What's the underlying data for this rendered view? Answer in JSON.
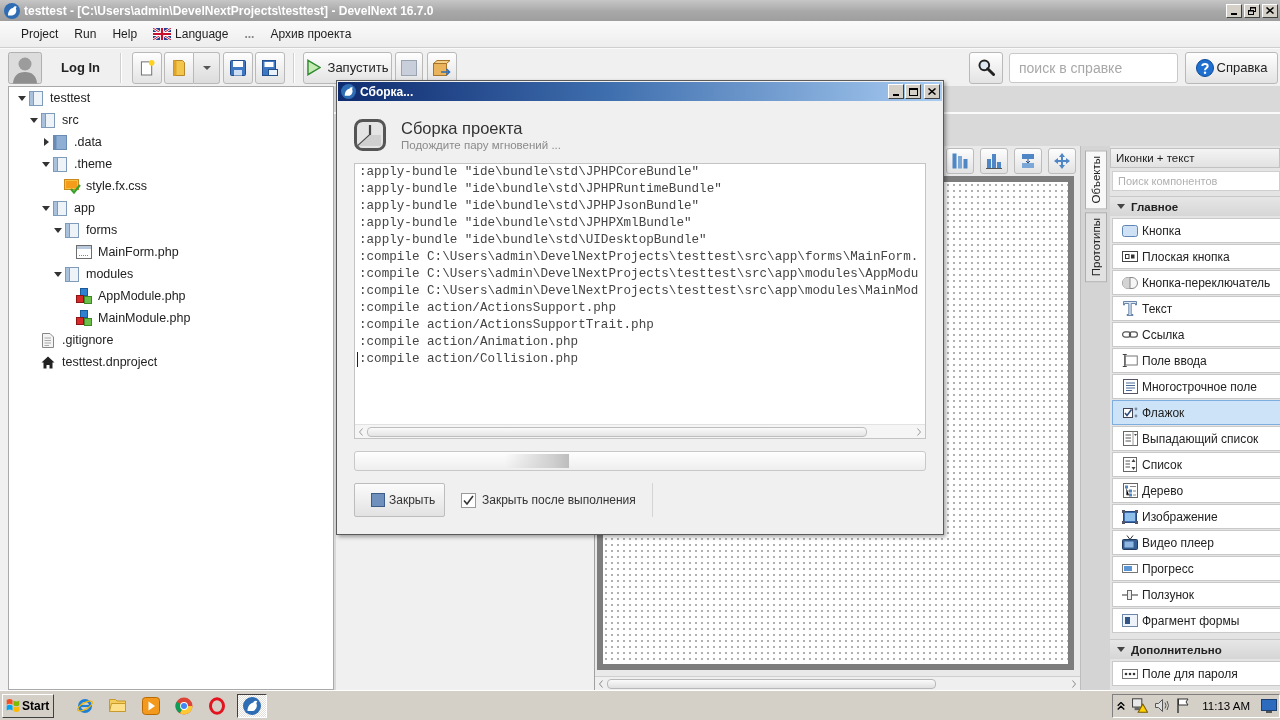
{
  "window": {
    "title": "testtest - [C:\\Users\\admin\\DevelNextProjects\\testtest] - DevelNext 16.7.0"
  },
  "menu": [
    {
      "label": "Project",
      "kind": "plain",
      "disabled": false
    },
    {
      "label": "Run",
      "kind": "plain",
      "disabled": false
    },
    {
      "label": "Help",
      "kind": "plain",
      "disabled": false
    },
    {
      "label": "Language",
      "kind": "flag",
      "disabled": false
    },
    {
      "label": "...",
      "kind": "plain",
      "disabled": true
    },
    {
      "label": "Архив проекта",
      "kind": "plain",
      "disabled": false
    }
  ],
  "toolbar": {
    "login": "Log In",
    "run_label": "Запустить",
    "help_search": {
      "placeholder": "поиск в справке"
    },
    "help_label": "Справка"
  },
  "project_tree": [
    {
      "label": "testtest",
      "kind": "folder",
      "expanded": true,
      "children": [
        {
          "label": "src",
          "kind": "folder",
          "expanded": true,
          "children": [
            {
              "label": ".data",
              "kind": "folder",
              "expanded": false
            },
            {
              "label": ".theme",
              "kind": "folder",
              "expanded": true,
              "children": [
                {
                  "label": "style.fx.css",
                  "kind": "stylesheet"
                }
              ]
            },
            {
              "label": "app",
              "kind": "folder",
              "expanded": true,
              "children": [
                {
                  "label": "forms",
                  "kind": "folder",
                  "expanded": true,
                  "children": [
                    {
                      "label": "MainForm.php",
                      "kind": "form"
                    }
                  ]
                },
                {
                  "label": "modules",
                  "kind": "folder",
                  "expanded": true,
                  "children": [
                    {
                      "label": "AppModule.php",
                      "kind": "module"
                    },
                    {
                      "label": "MainModule.php",
                      "kind": "module"
                    }
                  ]
                }
              ]
            }
          ]
        },
        {
          "label": ".gitignore",
          "kind": "text"
        },
        {
          "label": "testtest.dnproject",
          "kind": "project"
        }
      ]
    }
  ],
  "build_dialog": {
    "title": "Сборка...",
    "heading": "Сборка проекта",
    "subtitle": "Подождите пару мгновений ...",
    "log": [
      ":apply-bundle \"ide\\bundle\\std\\JPHPCoreBundle\"",
      ":apply-bundle \"ide\\bundle\\std\\JPHPRuntimeBundle\"",
      ":apply-bundle \"ide\\bundle\\std\\JPHPJsonBundle\"",
      ":apply-bundle \"ide\\bundle\\std\\JPHPXmlBundle\"",
      ":apply-bundle \"ide\\bundle\\std\\UIDesktopBundle\"",
      ":compile C:\\Users\\admin\\DevelNextProjects\\testtest\\src\\app\\forms\\MainForm.",
      ":compile C:\\Users\\admin\\DevelNextProjects\\testtest\\src\\app\\modules\\AppModu",
      ":compile C:\\Users\\admin\\DevelNextProjects\\testtest\\src\\app\\modules\\MainMod",
      ":compile action/ActionsSupport.php",
      ":compile action/ActionsSupportTrait.php",
      ":compile action/Animation.php",
      ":compile action/Collision.php"
    ],
    "progress": {
      "indeterminate": true
    },
    "close_button": "Закрыть",
    "close_after": {
      "label": "Закрыть после выполнения",
      "checked": true
    }
  },
  "component_panel": {
    "tabs": [
      {
        "label": "Объекты",
        "selected": true
      },
      {
        "label": "Прототипы",
        "selected": false
      }
    ],
    "view_mode": "Иконки + текст",
    "search": {
      "placeholder": "Поиск компонентов"
    },
    "sections": [
      {
        "title": "Главное",
        "expanded": true,
        "items": [
          {
            "label": "Кнопка",
            "kind": "button",
            "selected": false
          },
          {
            "label": "Плоская кнопка",
            "kind": "flat-button",
            "selected": false
          },
          {
            "label": "Кнопка-переключатель",
            "kind": "toggle",
            "selected": false
          },
          {
            "label": "Текст",
            "kind": "label",
            "selected": false
          },
          {
            "label": "Ссылка",
            "kind": "link",
            "selected": false
          },
          {
            "label": "Поле ввода",
            "kind": "text-field",
            "selected": false
          },
          {
            "label": "Многострочное поле",
            "kind": "text-area",
            "selected": false
          },
          {
            "label": "Флажок",
            "kind": "checkbox",
            "selected": true
          },
          {
            "label": "Выпадающий список",
            "kind": "combobox",
            "selected": false
          },
          {
            "label": "Список",
            "kind": "list",
            "selected": false
          },
          {
            "label": "Дерево",
            "kind": "tree",
            "selected": false
          },
          {
            "label": "Изображение",
            "kind": "image",
            "selected": false
          },
          {
            "label": "Видео плеер",
            "kind": "video",
            "selected": false
          },
          {
            "label": "Прогресс",
            "kind": "progress",
            "selected": false
          },
          {
            "label": "Ползунок",
            "kind": "slider",
            "selected": false
          },
          {
            "label": "Фрагмент формы",
            "kind": "fragment",
            "selected": false
          }
        ]
      },
      {
        "title": "Дополнительно",
        "expanded": true,
        "items": [
          {
            "label": "Поле для пароля",
            "kind": "password",
            "selected": false
          }
        ]
      }
    ]
  },
  "taskbar": {
    "start": "Start",
    "apps": [
      {
        "kind": "browser",
        "active": false
      },
      {
        "kind": "explorer",
        "active": false
      },
      {
        "kind": "media",
        "active": false
      },
      {
        "kind": "chrome",
        "active": false
      },
      {
        "kind": "opera",
        "active": false
      },
      {
        "kind": "develnext",
        "active": true
      }
    ],
    "clock": "11:13 AM"
  }
}
